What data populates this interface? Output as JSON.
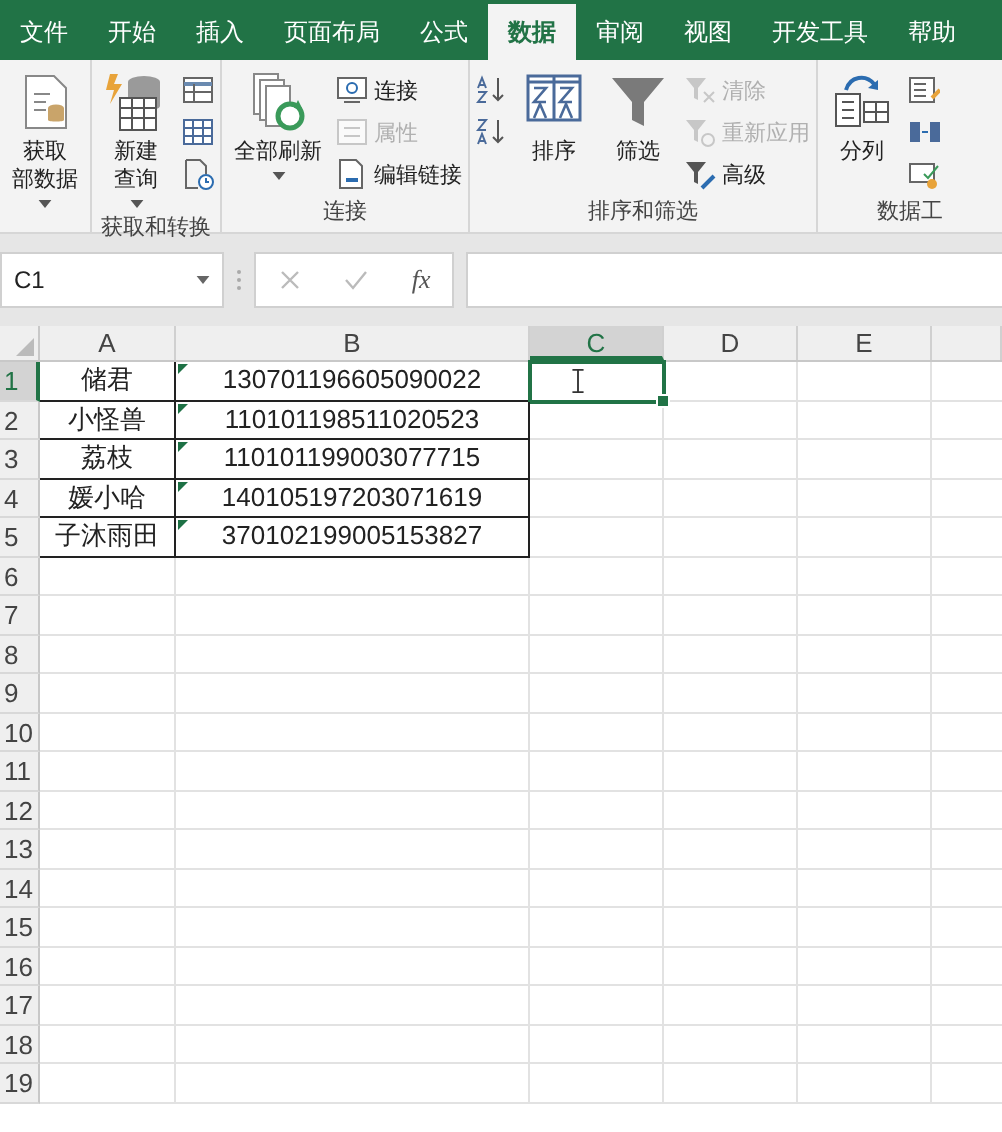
{
  "tabs": [
    {
      "label": "文件",
      "selected": false
    },
    {
      "label": "开始",
      "selected": false
    },
    {
      "label": "插入",
      "selected": false
    },
    {
      "label": "页面布局",
      "selected": false
    },
    {
      "label": "公式",
      "selected": false
    },
    {
      "label": "数据",
      "selected": true
    },
    {
      "label": "审阅",
      "selected": false
    },
    {
      "label": "视图",
      "selected": false
    },
    {
      "label": "开发工具",
      "selected": false
    },
    {
      "label": "帮助",
      "selected": false
    }
  ],
  "ribbon": {
    "groups": [
      {
        "items": [
          {
            "kind": "large",
            "lines": [
              "获取",
              "部数据"
            ],
            "dropdown": true
          }
        ]
      },
      {
        "label": "获取和转换",
        "items": [
          {
            "kind": "large",
            "lines": [
              "新建",
              "查询"
            ],
            "dropdown": true
          },
          {
            "kind": "icons"
          }
        ]
      },
      {
        "label": "连接",
        "items": [
          {
            "kind": "large",
            "lines": [
              "全部刷新"
            ],
            "dropdown": true
          },
          {
            "kind": "stack",
            "entries": [
              {
                "label": "连接",
                "disabled": false
              },
              {
                "label": "属性",
                "disabled": true
              },
              {
                "label": "编辑链接",
                "disabled": false
              }
            ]
          }
        ]
      },
      {
        "label": "排序和筛选",
        "items": [
          {
            "kind": "icons"
          },
          {
            "kind": "large",
            "lines": [
              "排序"
            ],
            "dropdown": false
          },
          {
            "kind": "large",
            "lines": [
              "筛选"
            ],
            "dropdown": false
          },
          {
            "kind": "stack",
            "entries": [
              {
                "label": "清除",
                "disabled": true
              },
              {
                "label": "重新应用",
                "disabled": true
              },
              {
                "label": "高级",
                "disabled": false
              }
            ]
          }
        ]
      },
      {
        "label": "数据工",
        "items": [
          {
            "kind": "large",
            "lines": [
              "分列"
            ],
            "dropdown": false
          },
          {
            "kind": "icons"
          }
        ]
      }
    ]
  },
  "formula_bar": {
    "name_box": "C1",
    "function_label": "fx"
  },
  "columns": [
    {
      "label": "A",
      "selected": false
    },
    {
      "label": "B",
      "selected": false
    },
    {
      "label": "C",
      "selected": true
    },
    {
      "label": "D",
      "selected": false
    },
    {
      "label": "E",
      "selected": false
    }
  ],
  "rows": [
    {
      "number": "1",
      "selected": true,
      "cells": [
        {
          "text": "储君",
          "flag": false
        },
        {
          "text": "130701196605090022",
          "flag": true
        }
      ]
    },
    {
      "number": "2",
      "selected": false,
      "cells": [
        {
          "text": "小怪兽",
          "flag": false
        },
        {
          "text": "110101198511020523",
          "flag": true
        }
      ]
    },
    {
      "number": "3",
      "selected": false,
      "cells": [
        {
          "text": "荔枝",
          "flag": false
        },
        {
          "text": "110101199003077715",
          "flag": true
        }
      ]
    },
    {
      "number": "4",
      "selected": false,
      "cells": [
        {
          "text": "媛小哈",
          "flag": false
        },
        {
          "text": "140105197203071619",
          "flag": true
        }
      ]
    },
    {
      "number": "5",
      "selected": false,
      "cells": [
        {
          "text": "子沐雨田",
          "flag": false
        },
        {
          "text": "370102199005153827",
          "flag": true
        }
      ]
    },
    {
      "number": "6",
      "selected": false
    },
    {
      "number": "7",
      "selected": false
    },
    {
      "number": "8",
      "selected": false
    },
    {
      "number": "9",
      "selected": false
    },
    {
      "number": "10",
      "selected": false
    },
    {
      "number": "11",
      "selected": false
    },
    {
      "number": "12",
      "selected": false
    },
    {
      "number": "13",
      "selected": false
    },
    {
      "number": "14",
      "selected": false
    },
    {
      "number": "15",
      "selected": false
    },
    {
      "number": "16",
      "selected": false
    },
    {
      "number": "17",
      "selected": false
    },
    {
      "number": "18",
      "selected": false
    },
    {
      "number": "19",
      "selected": false
    }
  ]
}
